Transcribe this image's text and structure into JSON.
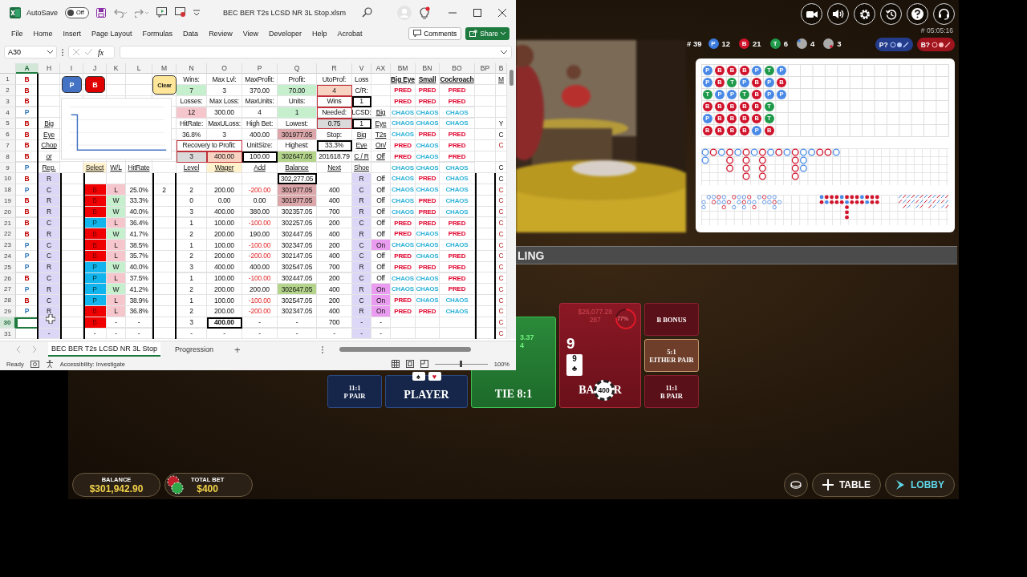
{
  "excel": {
    "autosave": {
      "label": "AutoSave",
      "state_text": "Off",
      "on": false
    },
    "file_name": "BEC BER T2s LCSD NR 3L Stop.xlsm",
    "menu": [
      "File",
      "Home",
      "Insert",
      "Page Layout",
      "Formulas",
      "Data",
      "Review",
      "View",
      "Developer",
      "Help",
      "Acrobat"
    ],
    "comments": "Comments",
    "share": "Share",
    "name_box": "A30",
    "fx": "fx",
    "columns": [
      {
        "name": "A",
        "selected": true
      },
      {
        "name": "H",
        "selected": false
      },
      {
        "name": "I",
        "selected": false
      },
      {
        "name": "J",
        "selected": false
      },
      {
        "name": "K",
        "selected": false
      },
      {
        "name": "L",
        "selected": false
      },
      {
        "name": "M",
        "selected": false
      },
      {
        "name": "N",
        "selected": false
      },
      {
        "name": "O",
        "selected": false
      },
      {
        "name": "P",
        "selected": false
      },
      {
        "name": "Q",
        "selected": false
      },
      {
        "name": "R",
        "selected": false
      },
      {
        "name": "V",
        "selected": false
      },
      {
        "name": "AX",
        "selected": false
      },
      {
        "name": "BM",
        "selected": false
      },
      {
        "name": "BN",
        "selected": false
      },
      {
        "name": "BO",
        "selected": false
      },
      {
        "name": "BP",
        "selected": false
      },
      {
        "name": "B",
        "selected": false
      }
    ],
    "rows": [
      {
        "num": "1",
        "selected": false,
        "cells": [
          {
            "text": "B",
            "kind": "banker"
          },
          null,
          null,
          null,
          null,
          null,
          null,
          {
            "text": "Wins:"
          },
          {
            "text": "Max Lvl:"
          },
          {
            "text": "MaxProfit:"
          },
          {
            "text": "Profit:"
          },
          {
            "text": "UtoProf:"
          },
          {
            "text": "Loss"
          },
          null,
          {
            "text": "Big Eye",
            "kind": "title"
          },
          {
            "text": "Small",
            "kind": "title"
          },
          {
            "text": "Cockroach",
            "kind": "title"
          },
          null,
          {
            "text": "M",
            "kind": "heading"
          }
        ]
      },
      {
        "num": "2",
        "selected": false,
        "cells": [
          {
            "text": "B",
            "kind": "banker"
          },
          null,
          null,
          null,
          null,
          null,
          null,
          {
            "text": "7",
            "kind": "good"
          },
          {
            "text": "3"
          },
          {
            "text": "370.00"
          },
          {
            "text": "70.00",
            "kind": "good"
          },
          {
            "text": "4",
            "kind": "target"
          },
          {
            "text": "C/R:"
          },
          null,
          {
            "text": "PRED",
            "kind": "pred"
          },
          {
            "text": "PRED",
            "kind": "pred"
          },
          {
            "text": "PRED",
            "kind": "pred"
          },
          null,
          null
        ]
      },
      {
        "num": "3",
        "selected": false,
        "cells": [
          {
            "text": "B",
            "kind": "banker"
          },
          null,
          null,
          null,
          null,
          null,
          null,
          {
            "text": "Losses:"
          },
          {
            "text": "Max Loss:"
          },
          {
            "text": "MaxUnits:"
          },
          {
            "text": "Units:"
          },
          {
            "text": "Wins",
            "kind": "framed"
          },
          {
            "text": "1",
            "kind": "boxed"
          },
          null,
          {
            "text": "PRED",
            "kind": "pred"
          },
          {
            "text": "PRED",
            "kind": "pred"
          },
          {
            "text": "PRED",
            "kind": "pred"
          },
          null,
          null
        ]
      },
      {
        "num": "4",
        "selected": false,
        "cells": [
          {
            "text": "P",
            "kind": "player"
          },
          null,
          null,
          null,
          null,
          null,
          null,
          {
            "text": "12",
            "kind": "bad"
          },
          {
            "text": "300.00"
          },
          {
            "text": "4"
          },
          {
            "text": "1",
            "kind": "good"
          },
          {
            "text": "Needed:",
            "kind": "framed"
          },
          {
            "text": "LCSD:"
          },
          {
            "text": "Big",
            "kind": "heading"
          },
          {
            "text": "CHAOS",
            "kind": "chaos"
          },
          {
            "text": "CHAOS",
            "kind": "chaos"
          },
          {
            "text": "CHAOS",
            "kind": "chaos"
          },
          null,
          null
        ]
      },
      {
        "num": "5",
        "selected": false,
        "cells": [
          {
            "text": "B",
            "kind": "banker"
          },
          {
            "text": "Big",
            "kind": "heading"
          },
          null,
          null,
          null,
          null,
          null,
          {
            "text": "HitRate:"
          },
          {
            "text": "MaxULoss:"
          },
          {
            "text": "High Bet:"
          },
          {
            "text": "Lowest:"
          },
          {
            "text": "0.75",
            "kind": "reading"
          },
          {
            "text": "1",
            "kind": "boxed"
          },
          {
            "text": "Eye",
            "kind": "heading"
          },
          {
            "text": "CHAOS",
            "kind": "chaos"
          },
          {
            "text": "CHAOS",
            "kind": "chaos"
          },
          {
            "text": "CHAOS",
            "kind": "chaos"
          },
          null,
          {
            "text": "Y"
          }
        ]
      },
      {
        "num": "6",
        "selected": false,
        "cells": [
          {
            "text": "B",
            "kind": "banker"
          },
          {
            "text": "Eye",
            "kind": "heading"
          },
          null,
          null,
          null,
          null,
          null,
          {
            "text": "36.8%"
          },
          {
            "text": "3"
          },
          {
            "text": "400.00"
          },
          {
            "text": "301977.05",
            "kind": "low"
          },
          {
            "text": "Stop:"
          },
          {
            "text": "Big",
            "kind": "heading"
          },
          {
            "text": "T2s",
            "kind": "heading"
          },
          {
            "text": "CHAOS",
            "kind": "chaos"
          },
          {
            "text": "PRED",
            "kind": "pred"
          },
          {
            "text": "PRED",
            "kind": "pred"
          },
          null,
          {
            "text": "C"
          }
        ]
      },
      {
        "num": "7",
        "selected": false,
        "cells": [
          {
            "text": "B",
            "kind": "banker"
          },
          {
            "text": "Chop",
            "kind": "heading"
          },
          null,
          null,
          null,
          null,
          null,
          {
            "text": "Recovery to Profit:",
            "kind": "merged"
          },
          null,
          {
            "text": "UnitSize:"
          },
          {
            "text": "Highest:"
          },
          {
            "text": "33.3%",
            "kind": "boxed"
          },
          {
            "text": "Eye",
            "kind": "heading"
          },
          {
            "text": "On/",
            "kind": "heading"
          },
          {
            "text": "PRED",
            "kind": "pred"
          },
          {
            "text": "CHAOS",
            "kind": "chaos"
          },
          {
            "text": "PRED",
            "kind": "pred"
          },
          null,
          {
            "text": "C",
            "kind": "note"
          }
        ]
      },
      {
        "num": "8",
        "selected": false,
        "cells": [
          {
            "text": "B",
            "kind": "banker"
          },
          {
            "text": "or",
            "kind": "heading"
          },
          null,
          null,
          null,
          null,
          null,
          {
            "text": "3",
            "kind": "reading"
          },
          {
            "text": "400.00",
            "kind": "target"
          },
          {
            "text": "100.00",
            "kind": "boxed"
          },
          {
            "text": "302647.05",
            "kind": "high"
          },
          {
            "text": "201618.79"
          },
          {
            "text": "C / R",
            "kind": "heading"
          },
          {
            "text": "Off",
            "kind": "heading"
          },
          {
            "text": "PRED",
            "kind": "pred"
          },
          {
            "text": "CHAOS",
            "kind": "chaos"
          },
          {
            "text": "PRED",
            "kind": "pred"
          },
          null,
          null
        ]
      },
      {
        "num": "9",
        "selected": false,
        "cells": [
          {
            "text": "P",
            "kind": "player"
          },
          {
            "text": "Rep.",
            "kind": "heading"
          },
          null,
          {
            "text": "Select",
            "kind": "choice"
          },
          {
            "text": "W/L",
            "kind": "heading"
          },
          {
            "text": "HitRate",
            "kind": "heading"
          },
          null,
          {
            "text": "Level",
            "kind": "heading"
          },
          {
            "text": "Wager",
            "kind": "choice"
          },
          {
            "text": "Add",
            "kind": "heading"
          },
          {
            "text": "Balance",
            "kind": "heading"
          },
          {
            "text": "Next",
            "kind": "heading"
          },
          {
            "text": "Shoe",
            "kind": "heading"
          },
          null,
          {
            "text": "CHAOS",
            "kind": "chaos"
          },
          {
            "text": "CHAOS",
            "kind": "chaos"
          },
          {
            "text": "CHAOS",
            "kind": "chaos"
          },
          null,
          {
            "text": "C"
          }
        ]
      },
      {
        "num": "10",
        "selected": false,
        "cells": [
          {
            "text": "B",
            "kind": "banker"
          },
          {
            "text": "R",
            "kind": "marker"
          },
          null,
          null,
          null,
          null,
          null,
          null,
          null,
          null,
          {
            "text": "302,277.05",
            "kind": "boxed"
          },
          null,
          {
            "text": "R",
            "kind": "marker"
          },
          {
            "text": "Off"
          },
          {
            "text": "CHAOS",
            "kind": "chaos"
          },
          {
            "text": "PRED",
            "kind": "pred"
          },
          {
            "text": "CHAOS",
            "kind": "chaos"
          },
          null,
          {
            "text": "C"
          }
        ]
      },
      {
        "num": "18",
        "selected": false,
        "cells": [
          {
            "text": "P",
            "kind": "player"
          },
          {
            "text": "C",
            "kind": "marker"
          },
          null,
          {
            "text": "B",
            "kind": "bankerpick"
          },
          {
            "text": "L",
            "kind": "bad"
          },
          {
            "text": "25.0%"
          },
          {
            "text": "2"
          },
          {
            "text": "2"
          },
          {
            "text": "200.00"
          },
          {
            "text": "-200.00",
            "kind": "loss"
          },
          {
            "text": "301977.05",
            "kind": "low"
          },
          {
            "text": "400"
          },
          {
            "text": "C",
            "kind": "marker"
          },
          {
            "text": "Off"
          },
          {
            "text": "CHAOS",
            "kind": "chaos"
          },
          {
            "text": "CHAOS",
            "kind": "chaos"
          },
          {
            "text": "CHAOS",
            "kind": "chaos"
          },
          null,
          {
            "text": "C",
            "kind": "note"
          }
        ]
      },
      {
        "num": "19",
        "selected": false,
        "cells": [
          {
            "text": "B",
            "kind": "banker"
          },
          {
            "text": "R",
            "kind": "marker"
          },
          null,
          {
            "text": "B",
            "kind": "bankerpick"
          },
          {
            "text": "W",
            "kind": "good"
          },
          {
            "text": "33.3%"
          },
          null,
          {
            "text": "0"
          },
          {
            "text": "0.00"
          },
          {
            "text": "0.00"
          },
          {
            "text": "301977.05",
            "kind": "low"
          },
          {
            "text": "400"
          },
          {
            "text": "R",
            "kind": "marker"
          },
          {
            "text": "Off"
          },
          {
            "text": "CHAOS",
            "kind": "chaos"
          },
          {
            "text": "PRED",
            "kind": "pred"
          },
          {
            "text": "CHAOS",
            "kind": "chaos"
          },
          null,
          {
            "text": "C",
            "kind": "note"
          }
        ]
      },
      {
        "num": "20",
        "selected": false,
        "cells": [
          {
            "text": "B",
            "kind": "banker"
          },
          {
            "text": "R",
            "kind": "marker"
          },
          null,
          {
            "text": "B",
            "kind": "bankerpick"
          },
          {
            "text": "W",
            "kind": "good"
          },
          {
            "text": "40.0%"
          },
          null,
          {
            "text": "3"
          },
          {
            "text": "400.00"
          },
          {
            "text": "380.00"
          },
          {
            "text": "302357.05"
          },
          {
            "text": "700"
          },
          {
            "text": "R",
            "kind": "marker"
          },
          {
            "text": "Off"
          },
          {
            "text": "CHAOS",
            "kind": "chaos"
          },
          {
            "text": "PRED",
            "kind": "pred"
          },
          {
            "text": "CHAOS",
            "kind": "chaos"
          },
          null,
          {
            "text": "C",
            "kind": "note"
          }
        ]
      },
      {
        "num": "21",
        "selected": false,
        "cells": [
          {
            "text": "B",
            "kind": "banker"
          },
          {
            "text": "C",
            "kind": "marker"
          },
          null,
          {
            "text": "P",
            "kind": "playerpick"
          },
          {
            "text": "L",
            "kind": "bad"
          },
          {
            "text": "36.4%"
          },
          null,
          {
            "text": "1"
          },
          {
            "text": "100.00"
          },
          {
            "text": "-100.00",
            "kind": "loss"
          },
          {
            "text": "302257.05"
          },
          {
            "text": "200"
          },
          {
            "text": "C",
            "kind": "marker"
          },
          {
            "text": "Off"
          },
          {
            "text": "PRED",
            "kind": "pred"
          },
          {
            "text": "PRED",
            "kind": "pred"
          },
          {
            "text": "PRED",
            "kind": "pred"
          },
          null,
          {
            "text": "C",
            "kind": "note"
          }
        ]
      },
      {
        "num": "22",
        "selected": false,
        "cells": [
          {
            "text": "B",
            "kind": "banker"
          },
          {
            "text": "R",
            "kind": "marker"
          },
          null,
          {
            "text": "B",
            "kind": "bankerpick"
          },
          {
            "text": "W",
            "kind": "good"
          },
          {
            "text": "41.7%"
          },
          null,
          {
            "text": "2"
          },
          {
            "text": "200.00"
          },
          {
            "text": "190.00"
          },
          {
            "text": "302447.05"
          },
          {
            "text": "400"
          },
          {
            "text": "R",
            "kind": "marker"
          },
          {
            "text": "Off"
          },
          {
            "text": "PRED",
            "kind": "pred"
          },
          {
            "text": "CHAOS",
            "kind": "chaos"
          },
          {
            "text": "PRED",
            "kind": "pred"
          },
          null,
          {
            "text": "C",
            "kind": "note"
          }
        ]
      },
      {
        "num": "23",
        "selected": false,
        "cells": [
          {
            "text": "P",
            "kind": "player"
          },
          {
            "text": "C",
            "kind": "marker"
          },
          null,
          {
            "text": "B",
            "kind": "bankerpick"
          },
          {
            "text": "L",
            "kind": "bad"
          },
          {
            "text": "38.5%"
          },
          null,
          {
            "text": "1"
          },
          {
            "text": "100.00"
          },
          {
            "text": "-100.00",
            "kind": "loss"
          },
          {
            "text": "302347.05"
          },
          {
            "text": "200"
          },
          {
            "text": "C",
            "kind": "marker"
          },
          {
            "text": "On",
            "kind": "active"
          },
          {
            "text": "CHAOS",
            "kind": "chaos"
          },
          {
            "text": "CHAOS",
            "kind": "chaos"
          },
          {
            "text": "CHAOS",
            "kind": "chaos"
          },
          null,
          {
            "text": "C",
            "kind": "note"
          }
        ]
      },
      {
        "num": "24",
        "selected": false,
        "cells": [
          {
            "text": "P",
            "kind": "player"
          },
          {
            "text": "C",
            "kind": "marker"
          },
          null,
          {
            "text": "B",
            "kind": "bankerpick"
          },
          {
            "text": "L",
            "kind": "bad"
          },
          {
            "text": "35.7%"
          },
          null,
          {
            "text": "2"
          },
          {
            "text": "200.00"
          },
          {
            "text": "-200.00",
            "kind": "loss"
          },
          {
            "text": "302147.05"
          },
          {
            "text": "400"
          },
          {
            "text": "C",
            "kind": "marker"
          },
          {
            "text": "Off"
          },
          {
            "text": "PRED",
            "kind": "pred"
          },
          {
            "text": "CHAOS",
            "kind": "chaos"
          },
          {
            "text": "PRED",
            "kind": "pred"
          },
          null,
          {
            "text": "C",
            "kind": "note"
          }
        ]
      },
      {
        "num": "25",
        "selected": false,
        "cells": [
          {
            "text": "P",
            "kind": "player"
          },
          {
            "text": "R",
            "kind": "marker"
          },
          null,
          {
            "text": "P",
            "kind": "playerpick"
          },
          {
            "text": "W",
            "kind": "good"
          },
          {
            "text": "40.0%"
          },
          null,
          {
            "text": "3"
          },
          {
            "text": "400.00"
          },
          {
            "text": "400.00"
          },
          {
            "text": "302547.05"
          },
          {
            "text": "700"
          },
          {
            "text": "R",
            "kind": "marker"
          },
          {
            "text": "Off"
          },
          {
            "text": "PRED",
            "kind": "pred"
          },
          {
            "text": "PRED",
            "kind": "pred"
          },
          {
            "text": "PRED",
            "kind": "pred"
          },
          null,
          {
            "text": "C",
            "kind": "note"
          }
        ]
      },
      {
        "num": "26",
        "selected": false,
        "cells": [
          {
            "text": "B",
            "kind": "banker"
          },
          {
            "text": "C",
            "kind": "marker"
          },
          null,
          {
            "text": "P",
            "kind": "playerpick"
          },
          {
            "text": "L",
            "kind": "bad"
          },
          {
            "text": "37.5%"
          },
          null,
          {
            "text": "1"
          },
          {
            "text": "100.00"
          },
          {
            "text": "-100.00",
            "kind": "loss"
          },
          {
            "text": "302447.05"
          },
          {
            "text": "200"
          },
          {
            "text": "C",
            "kind": "marker"
          },
          {
            "text": "Off"
          },
          {
            "text": "CHAOS",
            "kind": "chaos"
          },
          {
            "text": "CHAOS",
            "kind": "chaos"
          },
          {
            "text": "PRED",
            "kind": "pred"
          },
          null,
          {
            "text": "C",
            "kind": "note"
          }
        ]
      },
      {
        "num": "27",
        "selected": false,
        "cells": [
          {
            "text": "P",
            "kind": "player"
          },
          {
            "text": "R",
            "kind": "marker"
          },
          null,
          {
            "text": "P",
            "kind": "playerpick"
          },
          {
            "text": "W",
            "kind": "good"
          },
          {
            "text": "41.2%"
          },
          null,
          {
            "text": "2"
          },
          {
            "text": "200.00"
          },
          {
            "text": "200.00"
          },
          {
            "text": "302647.05",
            "kind": "high"
          },
          {
            "text": "400"
          },
          {
            "text": "R",
            "kind": "marker"
          },
          {
            "text": "On",
            "kind": "active"
          },
          {
            "text": "CHAOS",
            "kind": "chaos"
          },
          {
            "text": "CHAOS",
            "kind": "chaos"
          },
          {
            "text": "PRED",
            "kind": "pred"
          },
          null,
          {
            "text": "C",
            "kind": "note"
          }
        ]
      },
      {
        "num": "28",
        "selected": false,
        "cells": [
          {
            "text": "B",
            "kind": "banker"
          },
          {
            "text": "C",
            "kind": "marker"
          },
          null,
          {
            "text": "P",
            "kind": "playerpick"
          },
          {
            "text": "L",
            "kind": "bad"
          },
          {
            "text": "38.9%"
          },
          null,
          {
            "text": "1"
          },
          {
            "text": "100.00"
          },
          {
            "text": "-100.00",
            "kind": "loss"
          },
          {
            "text": "302547.05"
          },
          {
            "text": "200"
          },
          {
            "text": "C",
            "kind": "marker"
          },
          {
            "text": "On",
            "kind": "active"
          },
          {
            "text": "PRED",
            "kind": "pred"
          },
          {
            "text": "CHAOS",
            "kind": "chaos"
          },
          {
            "text": "CHAOS",
            "kind": "chaos"
          },
          null,
          {
            "text": "C",
            "kind": "note"
          }
        ]
      },
      {
        "num": "29",
        "selected": false,
        "cells": [
          {
            "text": "P",
            "kind": "player"
          },
          {
            "text": "R",
            "kind": "marker"
          },
          null,
          {
            "text": "B",
            "kind": "bankerpick"
          },
          {
            "text": "L",
            "kind": "bad"
          },
          {
            "text": "36.8%"
          },
          null,
          {
            "text": "2"
          },
          {
            "text": "200.00"
          },
          {
            "text": "-200.00",
            "kind": "loss"
          },
          {
            "text": "302347.05"
          },
          {
            "text": "400"
          },
          {
            "text": "R",
            "kind": "marker"
          },
          {
            "text": "On",
            "kind": "active"
          },
          {
            "text": "PRED",
            "kind": "pred"
          },
          {
            "text": "PRED",
            "kind": "pred"
          },
          {
            "text": "CHAOS",
            "kind": "chaos"
          },
          null,
          {
            "text": "C",
            "kind": "note"
          }
        ]
      },
      {
        "num": "30",
        "selected": true,
        "cells": [
          null,
          {
            "kind": "marker"
          },
          null,
          {
            "text": "B",
            "kind": "bankerpick"
          },
          {
            "text": "-"
          },
          {
            "text": "-"
          },
          null,
          {
            "text": "3"
          },
          {
            "text": "400.00",
            "kind": "current"
          },
          {
            "text": "-"
          },
          {
            "text": "-"
          },
          {
            "text": "700"
          },
          {
            "text": "-",
            "kind": "marker"
          },
          {
            "text": "-"
          },
          null,
          null,
          null,
          null,
          {
            "text": "C",
            "kind": "note"
          }
        ]
      },
      {
        "num": "31",
        "selected": false,
        "cells": [
          null,
          {
            "text": "-",
            "kind": "marker"
          },
          null,
          {
            "text": "-"
          },
          {
            "text": "-"
          },
          {
            "text": "-"
          },
          null,
          {
            "text": "-"
          },
          {
            "text": "-"
          },
          {
            "text": "-"
          },
          {
            "text": "-"
          },
          {
            "text": "-"
          },
          {
            "text": "-",
            "kind": "marker"
          },
          {
            "text": "-"
          },
          null,
          null,
          null,
          null,
          {
            "text": "C",
            "kind": "note"
          }
        ]
      }
    ],
    "sheet_buttons": [
      {
        "text": "P",
        "kind": "player"
      },
      {
        "text": "B",
        "kind": "banker"
      },
      {
        "text": "Clear",
        "kind": "clear"
      }
    ],
    "sheet_tabs": [
      {
        "label": "BEC BER T2s LCSD NR 3L Stop",
        "selected": true
      },
      {
        "label": "Progression",
        "selected": false
      }
    ],
    "new_sheet": "+",
    "status": "Ready",
    "accessibility": "Accessibility: Investigate",
    "zoom_slider": {
      "level": 0.5
    },
    "zoom": "100%"
  },
  "game": {
    "round_id": "# 05:05:16",
    "stats": {
      "total": "# 39",
      "items": [
        {
          "badge": "P",
          "count": "12",
          "kind": "player"
        },
        {
          "badge": "B",
          "count": "21",
          "kind": "banker"
        },
        {
          "badge": "T",
          "count": "6",
          "kind": "tie"
        },
        {
          "count": "4",
          "kind": "pair"
        },
        {
          "count": "3",
          "kind": "pair"
        }
      ]
    },
    "predict_buttons": [
      {
        "text": "P?",
        "kind": "player"
      },
      {
        "text": "B?",
        "kind": "banker"
      }
    ],
    "bead_road": [
      [
        {
          "text": "P",
          "kind": "player"
        },
        {
          "text": "B",
          "kind": "banker"
        },
        {
          "text": "B",
          "kind": "banker"
        },
        {
          "text": "B",
          "kind": "banker"
        },
        {
          "text": "P",
          "kind": "player"
        },
        {
          "text": "T",
          "kind": "tie"
        },
        {
          "text": "P",
          "kind": "player"
        }
      ],
      [
        {
          "text": "P",
          "kind": "player"
        },
        {
          "text": "B",
          "kind": "banker"
        },
        {
          "text": "T",
          "kind": "tie"
        },
        {
          "text": "P",
          "kind": "player"
        },
        {
          "text": "B",
          "kind": "banker"
        },
        {
          "text": "P",
          "kind": "player"
        },
        {
          "text": "B",
          "kind": "banker"
        }
      ],
      [
        {
          "text": "T",
          "kind": "tie"
        },
        {
          "text": "P",
          "kind": "player"
        },
        {
          "text": "P",
          "kind": "player"
        },
        {
          "text": "T",
          "kind": "tie"
        },
        {
          "text": "B",
          "kind": "banker"
        },
        {
          "text": "P",
          "kind": "player"
        },
        {
          "text": "P",
          "kind": "player"
        }
      ],
      [
        {
          "text": "B",
          "kind": "banker"
        },
        {
          "text": "B",
          "kind": "banker"
        },
        {
          "text": "B",
          "kind": "banker"
        },
        {
          "text": "B",
          "kind": "banker"
        },
        {
          "text": "B",
          "kind": "banker"
        },
        {
          "text": "T",
          "kind": "tie"
        }
      ],
      [
        {
          "text": "P",
          "kind": "player"
        },
        {
          "text": "B",
          "kind": "banker"
        },
        {
          "text": "B",
          "kind": "banker"
        },
        {
          "text": "B",
          "kind": "banker"
        },
        {
          "text": "B",
          "kind": "banker"
        },
        {
          "text": "T",
          "kind": "tie"
        }
      ],
      [
        {
          "text": "B",
          "kind": "banker"
        },
        {
          "text": "B",
          "kind": "banker"
        },
        {
          "text": "B",
          "kind": "banker"
        },
        {
          "text": "B",
          "kind": "banker"
        },
        {
          "text": "P",
          "kind": "player"
        },
        {
          "text": "B",
          "kind": "banker"
        }
      ]
    ],
    "banner": "LING",
    "p_pair": {
      "odds": "11:1",
      "label": "P PAIR"
    },
    "player": {
      "label": "PLAYER",
      "cards": [
        "♠",
        "♥"
      ]
    },
    "tie": {
      "label": "TIE 8:1",
      "amounts": [
        "3.37",
        "4"
      ]
    },
    "banker": {
      "total": "$26,077.28",
      "players": "287",
      "percent": "77%",
      "score": "9",
      "card": {
        "rank": "9",
        "suit": "♣"
      },
      "label_parts": [
        "BA",
        "R"
      ],
      "chip": "400"
    },
    "b_bonus": {
      "label": "B BONUS"
    },
    "either_pair": {
      "odds": "5:1",
      "label": "EITHER PAIR"
    },
    "b_pair": {
      "odds": "11:1",
      "label": "B PAIR"
    },
    "balance": {
      "label": "BALANCE",
      "value": "$301,942.90"
    },
    "total_bet": {
      "label": "TOTAL BET",
      "value": "$400"
    },
    "table_button": "TABLE",
    "lobby_button": "LOBBY"
  }
}
